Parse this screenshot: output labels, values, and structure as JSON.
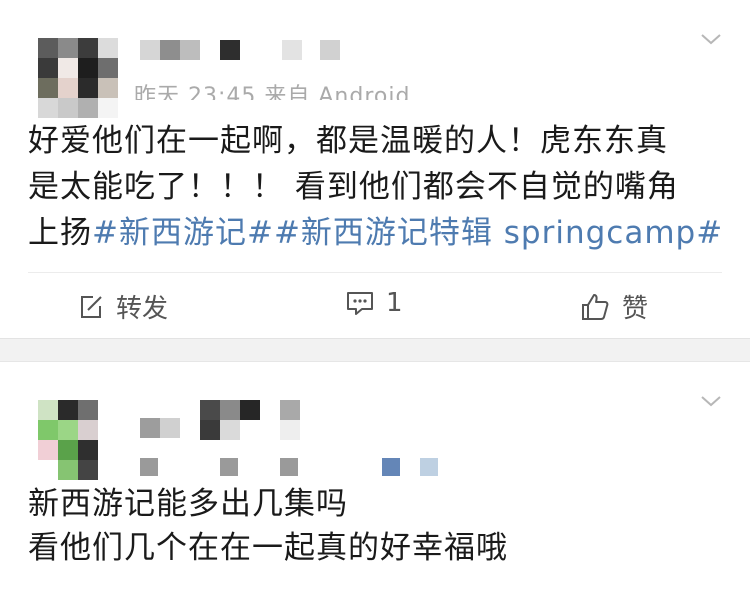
{
  "posts": [
    {
      "meta": "昨天 23:45  来自 Android",
      "text_lines": [
        "好爱他们在一起啊，都是温暖的人！虎东东真",
        "是太能吃了！！！ 看到他们都会不自觉的嘴角"
      ],
      "text_line3_prefix": "上扬",
      "hashtags": [
        "#新西游记#",
        "#新西游记特辑 springcamp#"
      ],
      "actions": {
        "repost_label": "转发",
        "comment_count": "1",
        "like_label": "赞"
      }
    },
    {
      "text_lines": [
        "新西游记能多出几集吗",
        "看他们几个在在一起真的好幸福哦"
      ]
    }
  ],
  "icons": [
    "chevron-down-icon",
    "repost-icon",
    "comment-icon",
    "like-icon"
  ],
  "colors": {
    "hashtag": "#4e7bb0",
    "separator": "#f2f2f2",
    "meta": "#aaaaaa",
    "text": "#1a1a1a"
  }
}
